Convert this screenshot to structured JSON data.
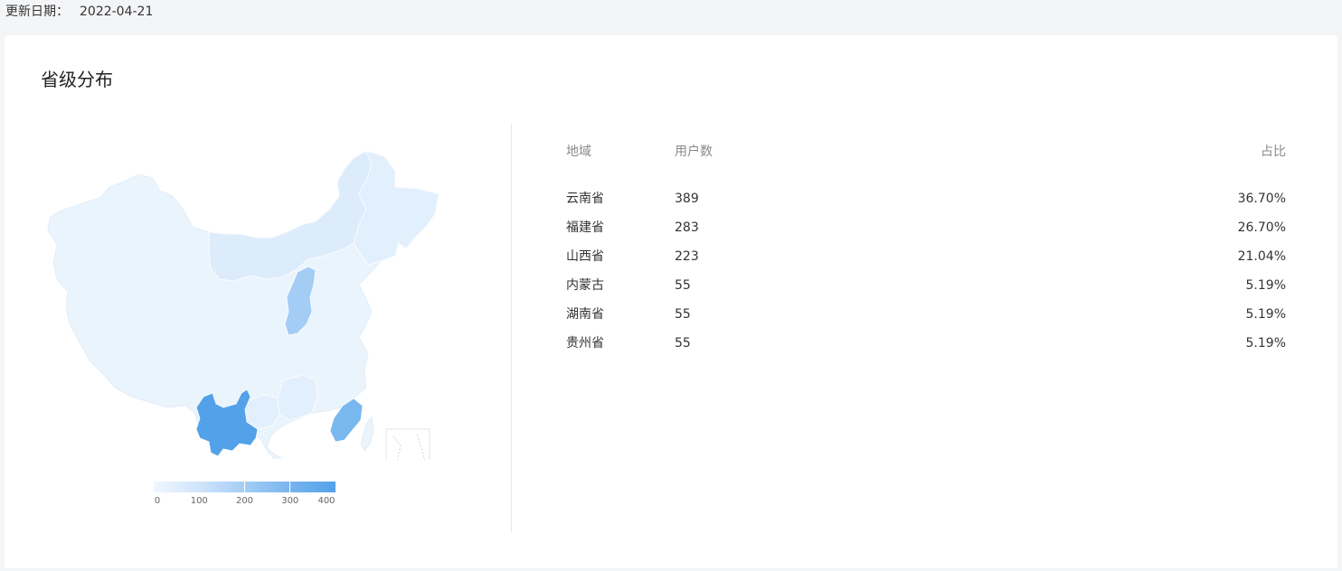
{
  "update": {
    "label": "更新日期：",
    "date": "2022-04-21"
  },
  "card": {
    "title": "省级分布"
  },
  "legend": {
    "ticks": [
      "0",
      "100",
      "200",
      "300",
      "400"
    ],
    "min": 0,
    "max": 400
  },
  "table": {
    "headers": {
      "region": "地域",
      "users": "用户数",
      "pct": "占比"
    },
    "rows": [
      {
        "region": "云南省",
        "users": "389",
        "pct": "36.70%"
      },
      {
        "region": "福建省",
        "users": "283",
        "pct": "26.70%"
      },
      {
        "region": "山西省",
        "users": "223",
        "pct": "21.04%"
      },
      {
        "region": "内蒙古",
        "users": "55",
        "pct": "5.19%"
      },
      {
        "region": "湖南省",
        "users": "55",
        "pct": "5.19%"
      },
      {
        "region": "贵州省",
        "users": "55",
        "pct": "5.19%"
      }
    ]
  },
  "colors": {
    "base": "#eaf4fd",
    "low": "#dcecfb",
    "mid": "#a4cdf5",
    "high": "#79b7ef",
    "max": "#53a2e9"
  }
}
